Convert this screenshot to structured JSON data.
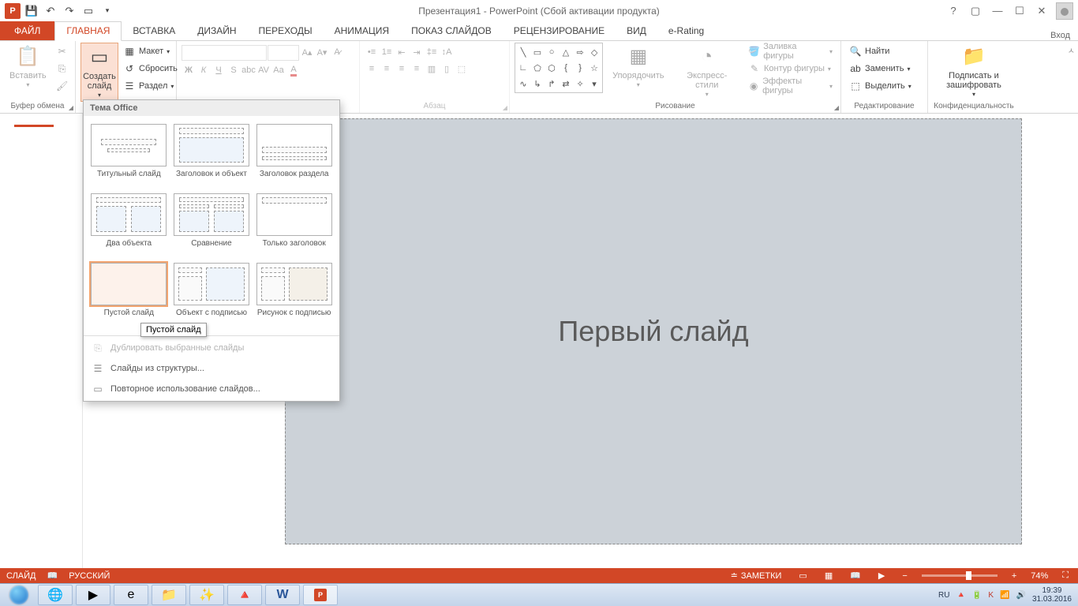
{
  "title": "Презентация1 - PowerPoint (Сбой активации продукта)",
  "signin": "Вход",
  "tabs": {
    "file": "ФАЙЛ",
    "home": "ГЛАВНАЯ",
    "insert": "ВСТАВКА",
    "design": "ДИЗАЙН",
    "transitions": "ПЕРЕХОДЫ",
    "animations": "АНИМАЦИЯ",
    "slideshow": "ПОКАЗ СЛАЙДОВ",
    "review": "РЕЦЕНЗИРОВАНИЕ",
    "view": "ВИД",
    "erating": "e-Rating"
  },
  "ribbon": {
    "clipboard": {
      "paste": "Вставить",
      "label": "Буфер обмена"
    },
    "slides": {
      "new_slide": "Создать слайд",
      "layout": "Макет",
      "reset": "Сбросить",
      "section": "Раздел"
    },
    "paragraph_label": "Абзац",
    "drawing": {
      "arrange": "Упорядочить",
      "quick_styles": "Экспресс-стили",
      "fill": "Заливка фигуры",
      "outline": "Контур фигуры",
      "effects": "Эффекты фигуры",
      "label": "Рисование"
    },
    "editing": {
      "find": "Найти",
      "replace": "Заменить",
      "select": "Выделить",
      "label": "Редактирование"
    },
    "protect": {
      "btn": "Подписать и зашифровать",
      "label": "Конфиденциальность"
    }
  },
  "layout_menu": {
    "header": "Тема Office",
    "items": [
      "Титульный слайд",
      "Заголовок и объект",
      "Заголовок раздела",
      "Два объекта",
      "Сравнение",
      "Только заголовок",
      "Пустой слайд",
      "Объект с подписью",
      "Рисунок с подписью"
    ],
    "tooltip": "Пустой слайд",
    "dup": "Дублировать выбранные слайды",
    "outline": "Слайды из структуры...",
    "reuse": "Повторное использование слайдов..."
  },
  "slide_text": "Первый слайд",
  "status": {
    "slide": "СЛАЙД",
    "lang": "РУССКИЙ",
    "notes": "ЗАМЕТКИ",
    "zoom": "74%"
  },
  "tray": {
    "lang": "RU",
    "time": "19:39",
    "date": "31.03.2016"
  }
}
